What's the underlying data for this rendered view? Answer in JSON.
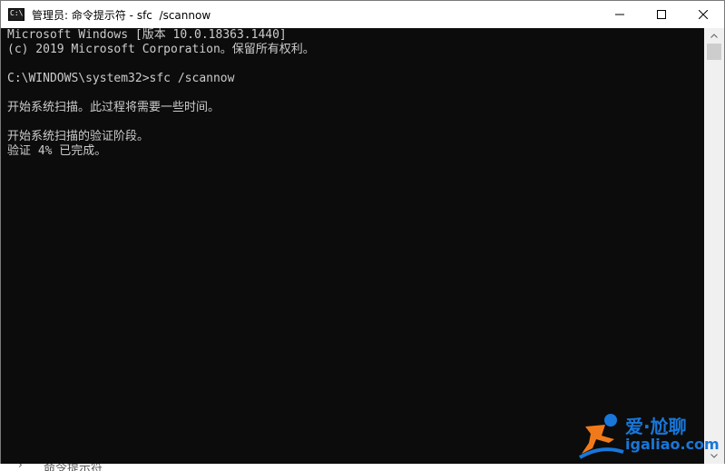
{
  "window": {
    "title": "管理员: 命令提示符 - sfc  /scannow",
    "icon_label": "C:\\"
  },
  "console": {
    "lines": [
      "Microsoft Windows [版本 10.0.18363.1440]",
      "(c) 2019 Microsoft Corporation。保留所有权利。",
      "",
      "C:\\WINDOWS\\system32>sfc /scannow",
      "",
      "开始系统扫描。此过程将需要一些时间。",
      "",
      "开始系统扫描的验证阶段。",
      "验证 4% 已完成。"
    ]
  },
  "watermark": {
    "line1": "爱·尬聊",
    "line2": "igaliao.com"
  },
  "behind": {
    "label": "命令提示符"
  },
  "colors": {
    "console_bg": "#0c0c0c",
    "console_fg": "#cccccc",
    "titlebar_bg": "#ffffff",
    "watermark_blue": "#1877d9",
    "watermark_orange": "#f07a1a"
  },
  "icons": {
    "minimize": "minimize-icon",
    "maximize": "maximize-icon",
    "close": "close-icon",
    "scroll_up": "chevron-up-icon",
    "scroll_down": "chevron-down-icon"
  }
}
